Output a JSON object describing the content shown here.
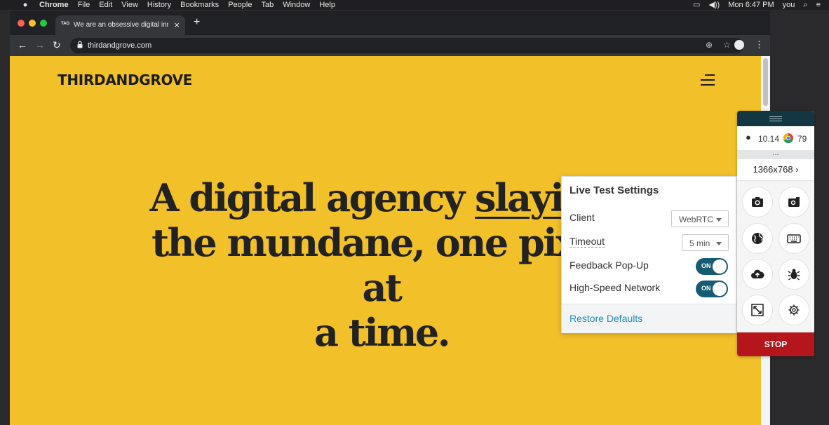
{
  "menubar": {
    "apple": "",
    "app": "Chrome",
    "items": [
      "File",
      "Edit",
      "View",
      "History",
      "Bookmarks",
      "People",
      "Tab",
      "Window",
      "Help"
    ],
    "clock": "Mon 6:47 PM",
    "user": "you"
  },
  "browser": {
    "tab_favicon": "TAG",
    "tab_title": "We are an obsessive digital inn",
    "url": "thirdandgrove.com"
  },
  "page": {
    "logo": "THIRDANDGROVE",
    "headline_line1_pre": "A digital agency ",
    "headline_line1_u": "slaying",
    "headline_line2": "the mundane, one pixel at",
    "headline_line3": "a time."
  },
  "settings": {
    "title": "Live Test Settings",
    "client_label": "Client",
    "client_value": "WebRTC",
    "timeout_label": "Timeout",
    "timeout_value": "5 min",
    "feedback_label": "Feedback Pop-Up",
    "feedback_state": "ON",
    "network_label": "High-Speed Network",
    "network_state": "ON",
    "restore": "Restore Defaults"
  },
  "tools": {
    "os_version": "10.14",
    "browser_version": "79",
    "dots": "...",
    "resolution": "1366x768 ›",
    "stop": "STOP"
  },
  "colors": {
    "page_bg": "#f2c029",
    "toggle_on": "#155c73",
    "stop": "#b4161b",
    "link": "#1e8bb8"
  }
}
